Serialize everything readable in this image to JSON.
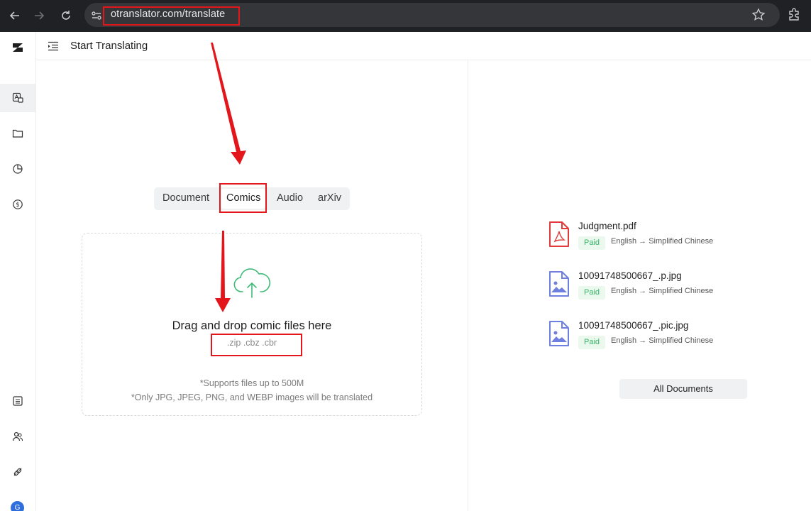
{
  "browser": {
    "url": "otranslator.com/translate",
    "icons": [
      "back-icon",
      "forward-icon",
      "reload-icon",
      "site-info-icon",
      "bookmark-star-icon",
      "extensions-icon"
    ]
  },
  "header": {
    "title": "Start Translating"
  },
  "sidebar": {
    "icons": [
      "logo-icon",
      "translate-icon",
      "folder-icon",
      "chart-icon",
      "billing-icon",
      "list-icon",
      "users-icon",
      "api-icon"
    ],
    "avatar_initial": "G"
  },
  "tabs": [
    {
      "label": "Document"
    },
    {
      "label": "Comics"
    },
    {
      "label": "Audio"
    },
    {
      "label": "arXiv"
    }
  ],
  "dropzone": {
    "title": "Drag and drop comic files here",
    "extensions": ".zip .cbz .cbr",
    "note_size": "*Supports files up to 500M",
    "note_formats": "*Only JPG, JPEG, PNG, and WEBP images will be translated"
  },
  "documents": [
    {
      "name": "Judgment.pdf",
      "status": "Paid",
      "languages": "English → Simplified Chinese",
      "icon": "pdf-file-icon"
    },
    {
      "name": "10091748500667_.p.jpg",
      "status": "Paid",
      "languages": "English → Simplified Chinese",
      "icon": "image-file-icon"
    },
    {
      "name": "10091748500667_.pic.jpg",
      "status": "Paid",
      "languages": "English → Simplified Chinese",
      "icon": "image-file-icon"
    }
  ],
  "all_documents_label": "All Documents",
  "colors": {
    "highlight": "#e3171b",
    "paid_badge_bg": "#eaf8ee",
    "paid_badge_text": "#3bb468",
    "pdf_red": "#e03a3a",
    "image_blue": "#6e7fe0",
    "cloud_green": "#3dbb76"
  }
}
